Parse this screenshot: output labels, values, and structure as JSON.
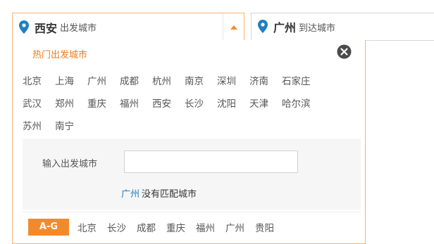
{
  "from_field": {
    "city": "西安",
    "hint": "出发城市"
  },
  "to_field": {
    "city": "广州",
    "hint": "到达城市"
  },
  "panel": {
    "title": "热门出发城市",
    "hot_cities": [
      "北京",
      "上海",
      "广州",
      "成都",
      "杭州",
      "南京",
      "深圳",
      "济南",
      "石家庄",
      "武汉",
      "郑州",
      "重庆",
      "福州",
      "西安",
      "长沙",
      "沈阳",
      "天津",
      "哈尔滨",
      "苏州",
      "南宁"
    ],
    "search": {
      "label": "输入出发城市",
      "value": "",
      "no_match_query": "广州",
      "no_match_text": "没有匹配城市"
    },
    "alpha": {
      "active_tab": "A-G",
      "cities": [
        "北京",
        "长沙",
        "成都",
        "重庆",
        "福州",
        "广州",
        "贵阳"
      ]
    }
  },
  "colors": {
    "accent": "#f28a2c",
    "pin": "#1f7fc4",
    "title": "#f07c1b",
    "link": "#1f7fc4"
  },
  "icons": {
    "pin": "map-pin-icon",
    "arrow": "caret-up-icon",
    "close": "close-circle-icon"
  }
}
